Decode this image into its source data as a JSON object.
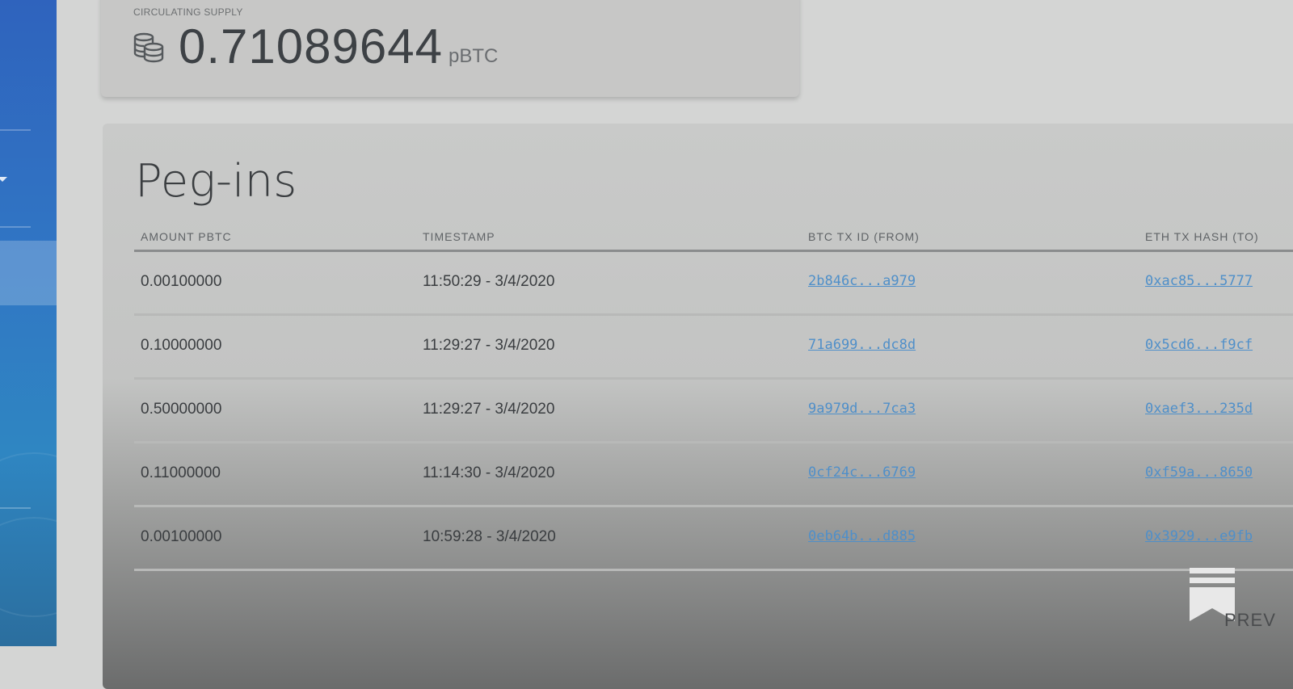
{
  "supply": {
    "label": "CIRCULATING SUPPLY",
    "value": "0.71089644",
    "unit": "pBTC",
    "icon": "coins-icon"
  },
  "pegins": {
    "title": "Peg-ins",
    "columns": [
      "AMOUNT pBTC",
      "TIMESTAMP",
      "BTC TX ID (FROM)",
      "ETH TX HASH (TO)"
    ],
    "rows": [
      {
        "amount": "0.00100000",
        "timestamp": "11:50:29 - 3/4/2020",
        "btc_tx": "2b846c...a979",
        "eth_tx": "0xac85...5777"
      },
      {
        "amount": "0.10000000",
        "timestamp": "11:29:27 - 3/4/2020",
        "btc_tx": "71a699...dc8d",
        "eth_tx": "0x5cd6...f9cf"
      },
      {
        "amount": "0.50000000",
        "timestamp": "11:29:27 - 3/4/2020",
        "btc_tx": "9a979d...7ca3",
        "eth_tx": "0xaef3...235d"
      },
      {
        "amount": "0.11000000",
        "timestamp": "11:14:30 - 3/4/2020",
        "btc_tx": "0cf24c...6769",
        "eth_tx": "0xf59a...8650"
      },
      {
        "amount": "0.00100000",
        "timestamp": "10:59:28 - 3/4/2020",
        "btc_tx": "0eb64b...d885",
        "eth_tx": "0x3929...e9fb"
      }
    ]
  },
  "pagination": {
    "prev_label": "PREV"
  },
  "colors": {
    "sidebar": "#2f6cc0",
    "link": "#4f8fc9",
    "text": "#3a3d40"
  }
}
